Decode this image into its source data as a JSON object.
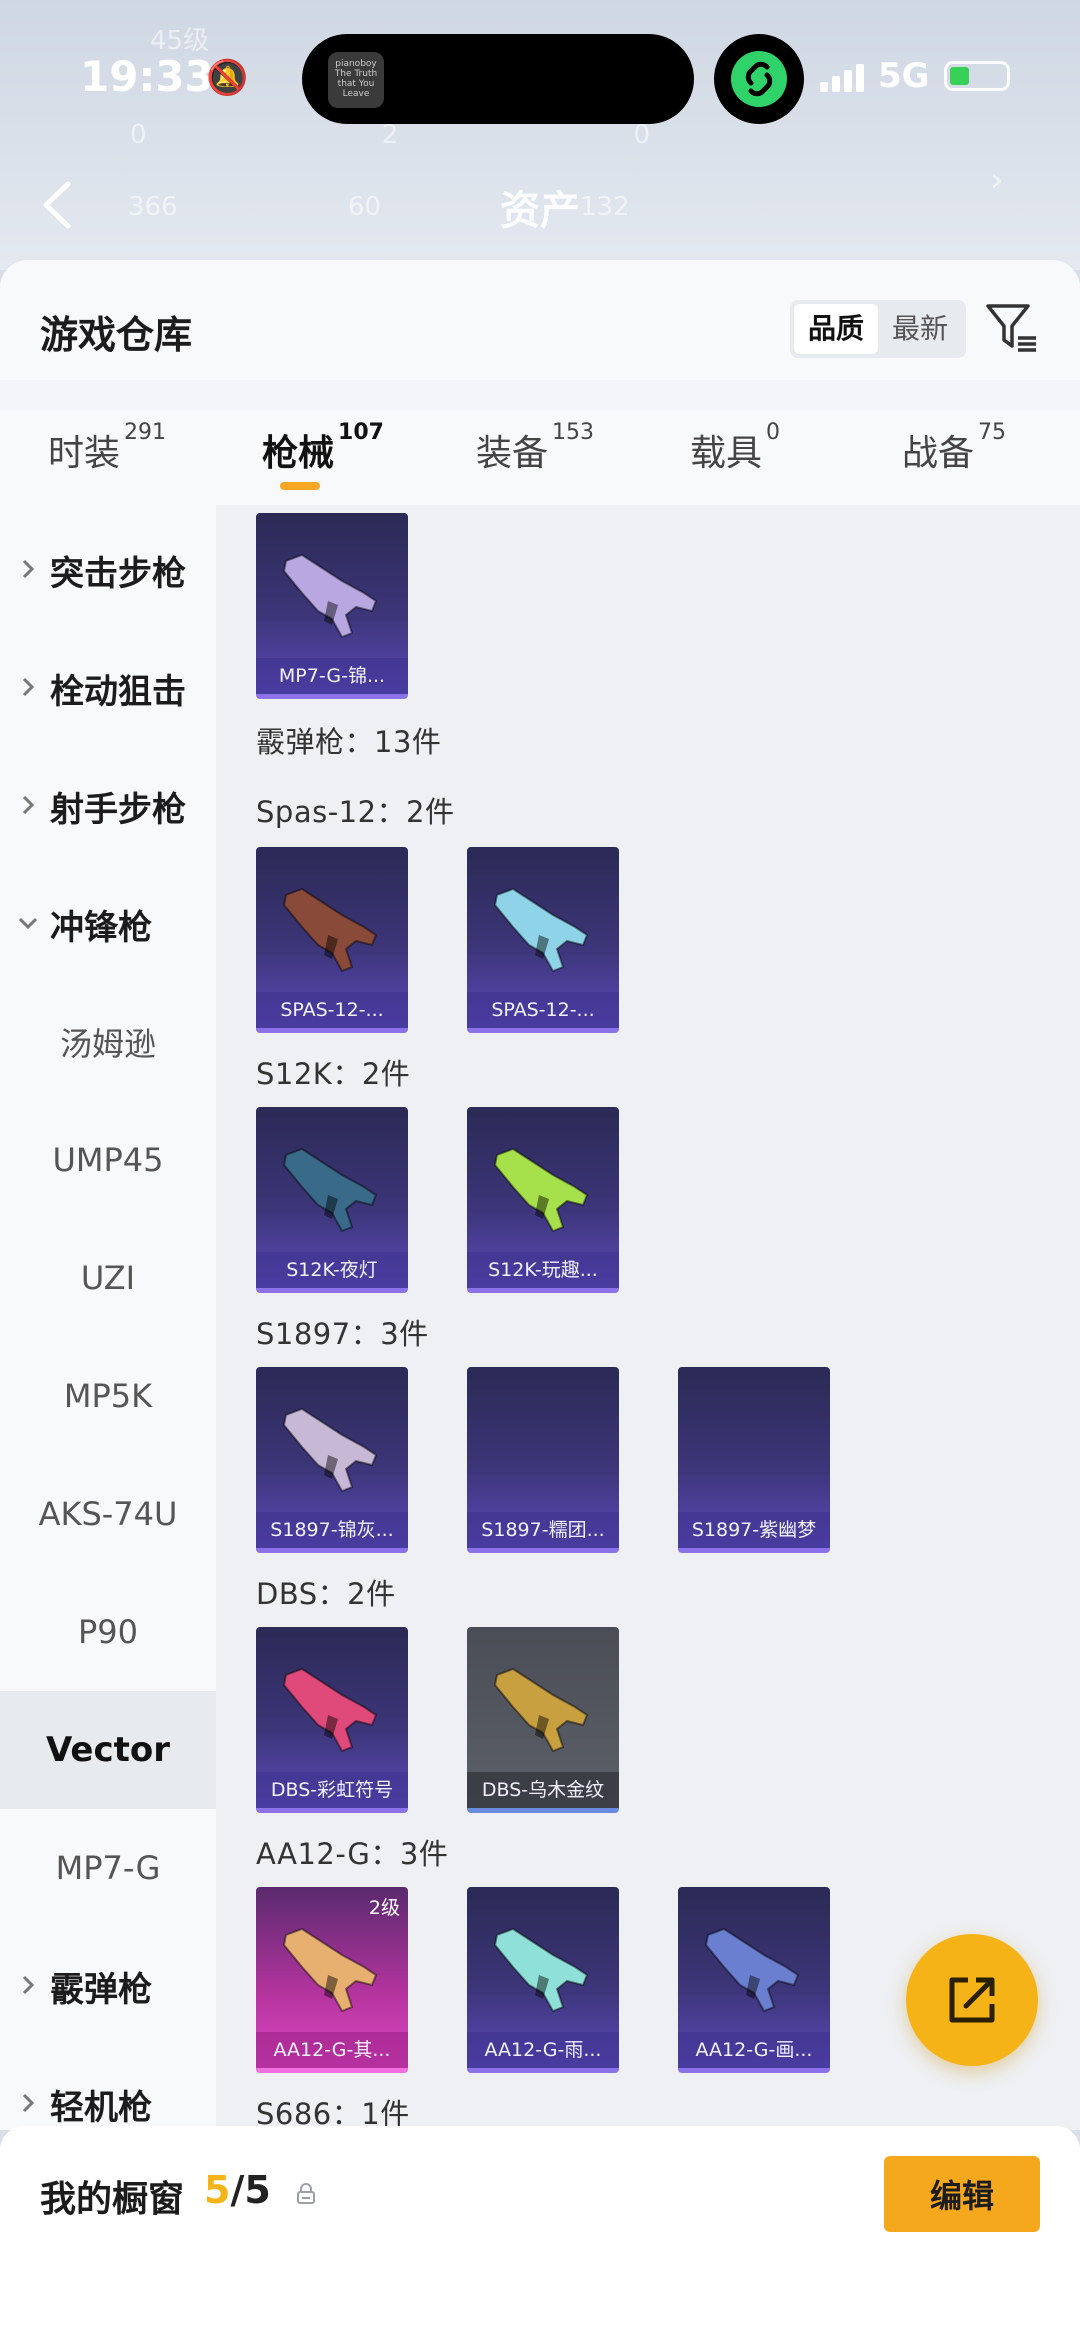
{
  "status_bar": {
    "time": "19:33",
    "network": "5G",
    "battery_level": 0.36,
    "island_app_text": "pianoboy The Truth that You Leave"
  },
  "background_blur": {
    "level": "45级",
    "stats_row1": [
      "0",
      "2",
      "0"
    ],
    "stats_row2": [
      "366",
      "60",
      "132"
    ],
    "title": "资产"
  },
  "panel": {
    "title": "游戏仓库",
    "sort_options": [
      {
        "label": "品质",
        "active": true
      },
      {
        "label": "最新",
        "active": false
      }
    ]
  },
  "tabs": [
    {
      "label": "时装",
      "count": "291",
      "active": false
    },
    {
      "label": "枪械",
      "count": "107",
      "active": true
    },
    {
      "label": "装备",
      "count": "153",
      "active": false
    },
    {
      "label": "载具",
      "count": "0",
      "active": false
    },
    {
      "label": "战备",
      "count": "75",
      "active": false
    }
  ],
  "sidebar": [
    {
      "label": "突击步枪",
      "type": "group",
      "expanded": false
    },
    {
      "label": "栓动狙击",
      "type": "group",
      "expanded": false
    },
    {
      "label": "射手步枪",
      "type": "group",
      "expanded": false
    },
    {
      "label": "冲锋枪",
      "type": "group",
      "expanded": true
    },
    {
      "label": "汤姆逊",
      "type": "sub"
    },
    {
      "label": "UMP45",
      "type": "sub"
    },
    {
      "label": "UZI",
      "type": "sub"
    },
    {
      "label": "MP5K",
      "type": "sub"
    },
    {
      "label": "AKS-74U",
      "type": "sub"
    },
    {
      "label": "P90",
      "type": "sub"
    },
    {
      "label": "Vector",
      "type": "sub",
      "selected": true
    },
    {
      "label": "MP7-G",
      "type": "sub"
    },
    {
      "label": "霰弹枪",
      "type": "group",
      "expanded": false
    },
    {
      "label": "轻机枪",
      "type": "group",
      "expanded": false
    }
  ],
  "content": {
    "top_card": {
      "name": "MP7-G-锦...",
      "color": "#b8a7e0"
    },
    "sections": [
      {
        "label": "霰弹枪：13件"
      },
      {
        "label": "Spas-12：2件"
      },
      {
        "label": "S12K：2件"
      },
      {
        "label": "S1897：3件"
      },
      {
        "label": "DBS：2件"
      },
      {
        "label": "AA12-G：3件"
      },
      {
        "label": "S686：1件"
      }
    ],
    "cards": {
      "spas": [
        {
          "name": "SPAS-12-...",
          "color": "#8a4a3a"
        },
        {
          "name": "SPAS-12-...",
          "color": "#8fd3e8"
        }
      ],
      "s12k": [
        {
          "name": "S12K-夜灯",
          "color": "#3a6a8a"
        },
        {
          "name": "S12K-玩趣...",
          "color": "#a6e04a"
        }
      ],
      "s1897": [
        {
          "name": "S1897-锦灰...",
          "color": "#c7b9d6"
        },
        {
          "name": "S1897-糯团...",
          "color": ""
        },
        {
          "name": "S1897-紫幽梦",
          "color": ""
        }
      ],
      "dbs": [
        {
          "name": "DBS-彩虹符号",
          "color": "#e04a7a"
        },
        {
          "name": "DBS-乌木金纹",
          "color": "#c9a040"
        }
      ],
      "aa12": [
        {
          "name": "AA12-G-其...",
          "color": "#e8b070",
          "badge": "2级"
        },
        {
          "name": "AA12-G-雨...",
          "color": "#8fe0d8"
        },
        {
          "name": "AA12-G-画...",
          "color": "#6a7fd0"
        }
      ]
    }
  },
  "showcase": {
    "title": "我的橱窗",
    "current": "5",
    "total": "/5",
    "edit_label": "编辑"
  },
  "colors": {
    "accent": "#f5b318",
    "tab_underline": "#f5a623",
    "card_purple": "#5a49b8"
  }
}
